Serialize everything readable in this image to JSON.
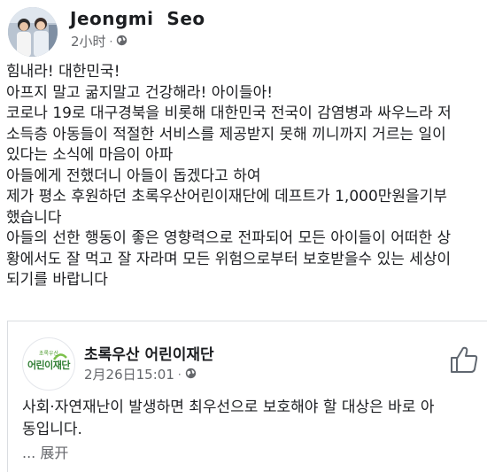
{
  "post": {
    "author": "Jeongmi  Seo",
    "time": "2小时",
    "audience_icon": "globe-icon",
    "lines": [
      "힘내라! 대한민국!",
      "아프지 말고 굶지말고 건강해라! 아이들아!",
      "코로나 19로 대구경북을 비롯해 대한민국 전국이 감염병과 싸우느라 저",
      "소득층 아동들이 적절한 서비스를 제공받지 못해 끼니까지 거르는 일이",
      "있다는 소식에 마음이 아파",
      "아들에게 전했더니 아들이 돕겠다고 하여",
      "제가 평소 후원하던 초록우산어린이재단에 데프트가 1,000만원을기부",
      "했습니다",
      "아들의 선한 행동이 좋은 영향력으로 전파되어 모든 아이들이 어떠한 상",
      "황에서도 잘 먹고 잘 자라며 모든 위험으로부터 보호받을수 있는 세상이",
      "되기를 바랍니다"
    ]
  },
  "shared": {
    "page_name": "초록우산 어린이재단",
    "logo_small": "초록우산",
    "logo_main": "어린이재단",
    "time": "2月26日15:01",
    "audience_icon": "globe-icon",
    "like_icon": "thumbs-up-icon",
    "lines": [
      "사회·자연재난이 발생하면 최우선으로 보호해야 할 대상은 바로 아",
      "동입니다."
    ],
    "expand_label": "... 展开"
  },
  "colors": {
    "text": "#1c1e21",
    "secondary": "#65676b",
    "logo_green": "#2e7d32"
  }
}
